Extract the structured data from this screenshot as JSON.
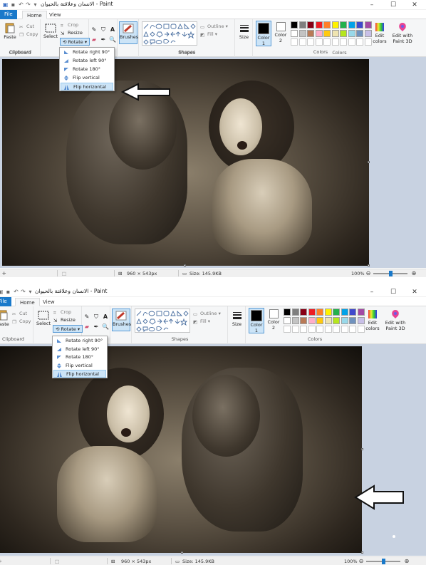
{
  "window": {
    "title": "الانسان وعلاقتة بالحيوان - Paint",
    "minimize_glyph": "–",
    "maximize_glyph": "☐",
    "close_glyph": "✕"
  },
  "tabs": {
    "file": "File",
    "home": "Home",
    "view": "View"
  },
  "ribbon": {
    "clipboard": {
      "paste": "Paste",
      "cut": "Cut",
      "copy": "Copy",
      "label": "Clipboard"
    },
    "image": {
      "select": "Select",
      "crop": "Crop",
      "resize": "Resize",
      "rotate": "Rotate",
      "label": "Image"
    },
    "brushes": "Brushes",
    "shapes": {
      "outline": "Outline",
      "fill": "Fill",
      "label": "Shapes"
    },
    "size": "Size",
    "colors": {
      "color1": "Color 1",
      "color2": "Color 2",
      "edit_colors": "Edit colors",
      "edit_paint3d": "Edit with Paint 3D",
      "label": "Colors",
      "color1_value": "#000000",
      "color2_value": "#ffffff",
      "palette_row1": [
        "#000000",
        "#7f7f7f",
        "#880015",
        "#ed1c24",
        "#ff7f27",
        "#fff200",
        "#22b14c",
        "#00a2e8",
        "#3f48cc",
        "#a349a4"
      ],
      "palette_row2": [
        "#ffffff",
        "#c3c3c3",
        "#b97a57",
        "#ffaec9",
        "#ffc90e",
        "#efe4b0",
        "#b5e61d",
        "#99d9ea",
        "#7092be",
        "#c8bfe7"
      ],
      "palette_row3": [
        "#ffffff",
        "#ffffff",
        "#ffffff",
        "#ffffff",
        "#ffffff",
        "#ffffff",
        "#ffffff",
        "#ffffff",
        "#ffffff",
        "#ffffff"
      ]
    }
  },
  "rotate_menu": {
    "items": [
      {
        "label": "Rotate right 90°",
        "icon": "rotate-right-icon"
      },
      {
        "label": "Rotate left 90°",
        "icon": "rotate-left-icon"
      },
      {
        "label": "Rotate 180°",
        "icon": "rotate-180-icon"
      },
      {
        "label": "Flip vertical",
        "icon": "flip-vertical-icon"
      },
      {
        "label": "Flip horizontal",
        "icon": "flip-horizontal-icon"
      }
    ],
    "highlighted_item": "Flip horizontal"
  },
  "status": {
    "dimensions": "960 × 543px",
    "size": "Size: 145.9KB",
    "zoom": "100%"
  },
  "annotation": {
    "arrow_icon": "hollow-arrow-icon"
  },
  "screenshots": [
    {
      "name": "before-flip",
      "image_orientation": "original"
    },
    {
      "name": "after-flip",
      "image_orientation": "flipped-horizontally"
    }
  ]
}
